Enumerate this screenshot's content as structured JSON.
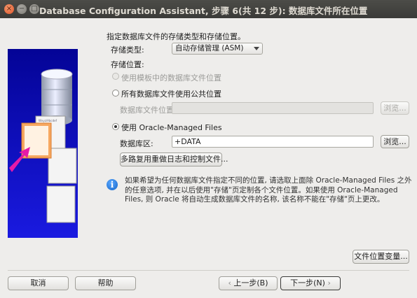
{
  "window": {
    "title": "Database Configuration Assistant, 步骤 6(共 12 步): 数据库文件所在位置",
    "controls": {
      "close": "×",
      "minimize": "−",
      "maximize": "□"
    }
  },
  "main": {
    "heading": "指定数据库文件的存储类型和存储位置。",
    "storage_type_label": "存储类型:",
    "storage_type_value": "自动存储管理 (ASM)",
    "storage_location_label": "存储位置:",
    "options": {
      "template": "使用模板中的数据库文件位置",
      "common": "所有数据库文件使用公共位置",
      "omf": "使用 Oracle-Managed Files"
    },
    "db_file_location_label": "数据库文件位置:",
    "db_file_location_value": "",
    "browse_label": "浏览...",
    "db_area_label": "数据库区:",
    "db_area_value": "+DATA",
    "multiplex_button": "多路复用重做日志和控制文件...",
    "info_text": "如果希望为任何数据库文件指定不同的位置, 请选取上面除 Oracle-Managed Files 之外的任意选项, 并在以后使用\"存储\"页定制各个文件位置。如果使用 Oracle-Managed Files, 则 Oracle 将自动生成数据库文件的名称, 该名称不能在\"存储\"页上更改。",
    "file_location_vars_button": "文件位置变量..."
  },
  "footer": {
    "cancel": "取消",
    "help": "帮助",
    "back": "上一步(B)",
    "next": "下一步(N)"
  },
  "illustration": {
    "doc_text": "Wxyz/Abcdef"
  }
}
